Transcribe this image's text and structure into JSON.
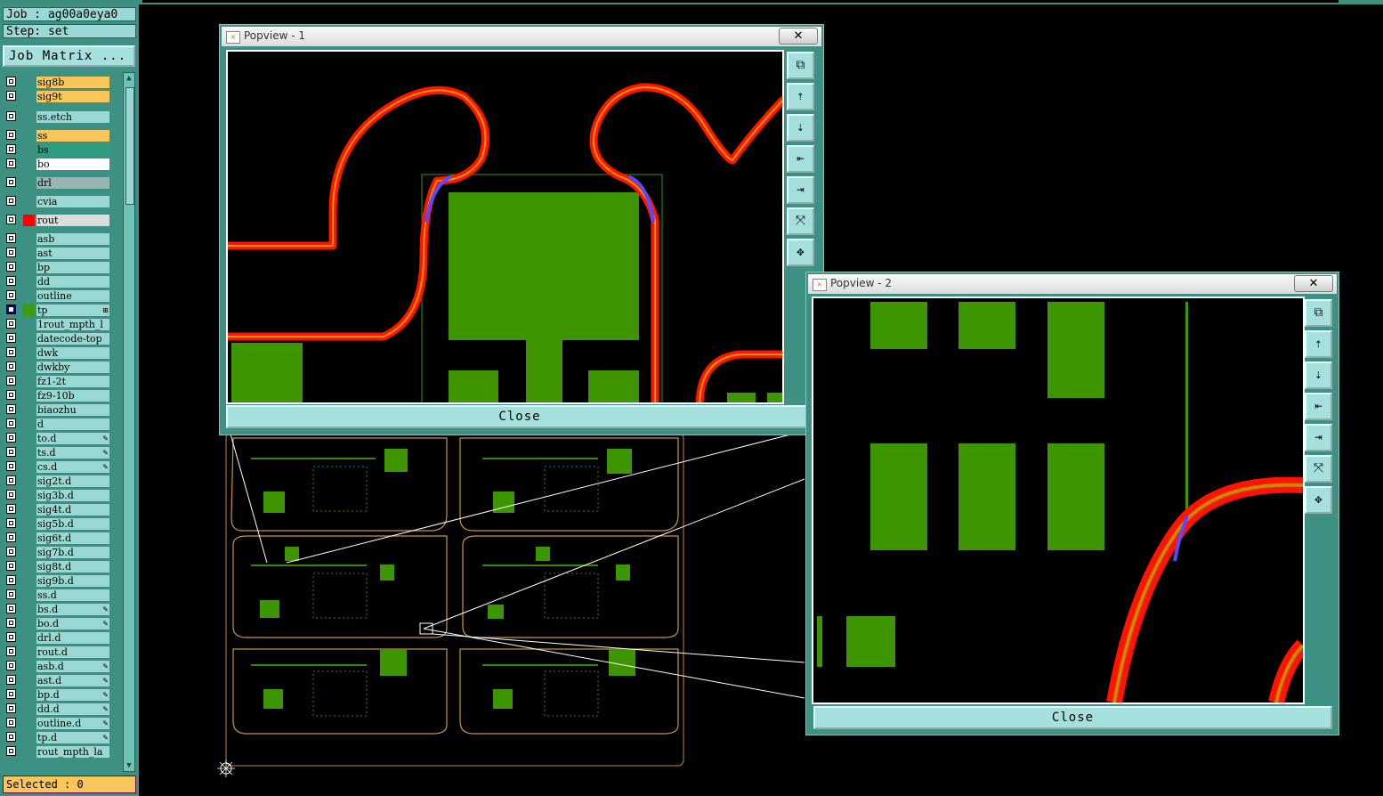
{
  "left_panel": {
    "job": "Job : ag00a0eya0",
    "step": "Step: set",
    "job_matrix": "Job Matrix ...",
    "layers": [
      {
        "name": "sig8b",
        "color": "#f8c65b"
      },
      {
        "name": "sig9t",
        "color": "#f8c65b"
      },
      {
        "name": "ss.etch",
        "color": "#9ad8d4"
      },
      {
        "name": "ss",
        "color": "#f8c65b"
      },
      {
        "name": "bs",
        "color": "#2e9c80"
      },
      {
        "name": "bo",
        "color": "#ffffff"
      },
      {
        "name": "drl",
        "color": "#9ab4b4"
      },
      {
        "name": "cvia",
        "color": "#9ad8d4"
      },
      {
        "name": "rout",
        "color": "#dcdcdc",
        "swatch": "#ff0000"
      },
      {
        "name": "asb"
      },
      {
        "name": "ast"
      },
      {
        "name": "bp"
      },
      {
        "name": "dd"
      },
      {
        "name": "outline"
      },
      {
        "name": "tp",
        "swatch": "#3a9a10",
        "active": true,
        "mark": "⊞"
      },
      {
        "name": "1rout_mpth_l"
      },
      {
        "name": "datecode-top"
      },
      {
        "name": "dwk"
      },
      {
        "name": "dwkby"
      },
      {
        "name": "fz1-2t"
      },
      {
        "name": "fz9-10b"
      },
      {
        "name": "biaozhu"
      },
      {
        "name": "d"
      },
      {
        "name": "to.d",
        "mark": "✎"
      },
      {
        "name": "ts.d",
        "mark": "✎"
      },
      {
        "name": "cs.d",
        "mark": "✎"
      },
      {
        "name": "sig2t.d"
      },
      {
        "name": "sig3b.d"
      },
      {
        "name": "sig4t.d"
      },
      {
        "name": "sig5b.d"
      },
      {
        "name": "sig6t.d"
      },
      {
        "name": "sig7b.d"
      },
      {
        "name": "sig8t.d"
      },
      {
        "name": "sig9b.d"
      },
      {
        "name": "ss.d"
      },
      {
        "name": "bs.d",
        "mark": "✎"
      },
      {
        "name": "bo.d",
        "mark": "✎"
      },
      {
        "name": "drl.d"
      },
      {
        "name": "rout.d"
      },
      {
        "name": "asb.d",
        "mark": "✎"
      },
      {
        "name": "ast.d",
        "mark": "✎"
      },
      {
        "name": "bp.d",
        "mark": "✎"
      },
      {
        "name": "dd.d",
        "mark": "✎"
      },
      {
        "name": "outline.d",
        "mark": "✎"
      },
      {
        "name": "tp.d",
        "mark": "✎"
      },
      {
        "name": "rout_mpth_la"
      }
    ],
    "selected": "Selected : 0"
  },
  "popview1": {
    "title": "Popview - 1",
    "close_x": "✕",
    "close_label": "Close"
  },
  "popview2": {
    "title": "Popview - 2",
    "close_x": "✕",
    "close_label": "Close"
  },
  "toolbar_icons": [
    "zoom-window-icon",
    "zoom-in-icon",
    "zoom-out-icon",
    "pan-left-icon",
    "pan-right-icon",
    "zoom-fit-icon",
    "zoom-home-icon"
  ],
  "colors": {
    "panel": "#3d9183",
    "copper": "#3d9600",
    "route": "#ff1a00",
    "highlight": "#f8c65b"
  }
}
